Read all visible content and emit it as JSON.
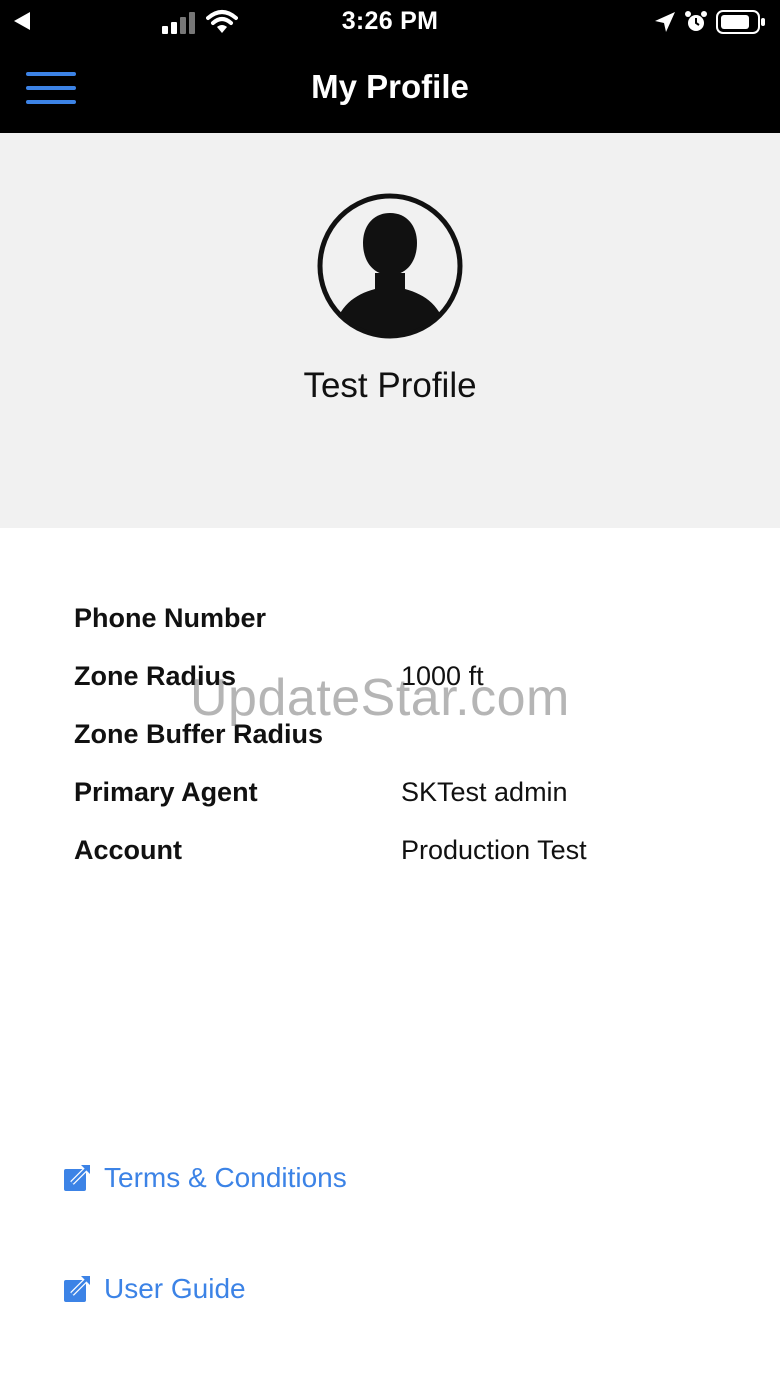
{
  "status_bar": {
    "time": "3:26 PM",
    "icons": [
      "back-arrow-icon",
      "cellular-signal-icon",
      "wifi-icon",
      "location-arrow-icon",
      "alarm-icon",
      "battery-icon"
    ]
  },
  "nav": {
    "title": "My Profile",
    "menu_icon": "hamburger-menu-icon",
    "bar_color": "#000000",
    "accent_color": "#3c83e6"
  },
  "profile": {
    "name": "Test Profile",
    "avatar_icon": "user-avatar-icon"
  },
  "info": [
    {
      "label": "Phone Number",
      "value": ""
    },
    {
      "label": "Zone Radius",
      "value": "1000 ft"
    },
    {
      "label": "Zone Buffer Radius",
      "value": ""
    },
    {
      "label": "Primary Agent",
      "value": "SKTest admin"
    },
    {
      "label": "Account",
      "value": "Production Test"
    }
  ],
  "links": [
    {
      "label": "Terms & Conditions",
      "icon": "external-link-icon"
    },
    {
      "label": "User Guide",
      "icon": "external-link-icon"
    }
  ],
  "watermark": "UpdateStar.com"
}
